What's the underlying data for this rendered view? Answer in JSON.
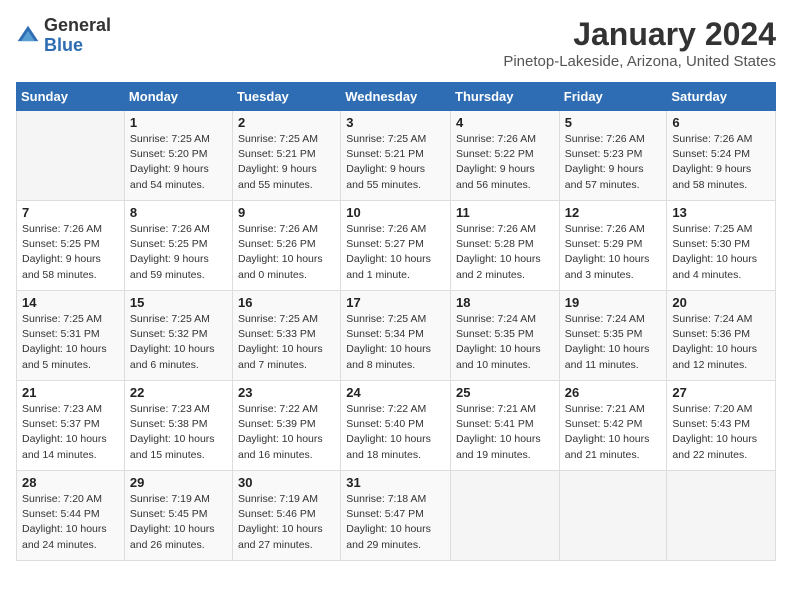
{
  "header": {
    "logo_general": "General",
    "logo_blue": "Blue",
    "month": "January 2024",
    "location": "Pinetop-Lakeside, Arizona, United States"
  },
  "days_of_week": [
    "Sunday",
    "Monday",
    "Tuesday",
    "Wednesday",
    "Thursday",
    "Friday",
    "Saturday"
  ],
  "weeks": [
    [
      {
        "day": "",
        "data": ""
      },
      {
        "day": "1",
        "data": "Sunrise: 7:25 AM\nSunset: 5:20 PM\nDaylight: 9 hours\nand 54 minutes."
      },
      {
        "day": "2",
        "data": "Sunrise: 7:25 AM\nSunset: 5:21 PM\nDaylight: 9 hours\nand 55 minutes."
      },
      {
        "day": "3",
        "data": "Sunrise: 7:25 AM\nSunset: 5:21 PM\nDaylight: 9 hours\nand 55 minutes."
      },
      {
        "day": "4",
        "data": "Sunrise: 7:26 AM\nSunset: 5:22 PM\nDaylight: 9 hours\nand 56 minutes."
      },
      {
        "day": "5",
        "data": "Sunrise: 7:26 AM\nSunset: 5:23 PM\nDaylight: 9 hours\nand 57 minutes."
      },
      {
        "day": "6",
        "data": "Sunrise: 7:26 AM\nSunset: 5:24 PM\nDaylight: 9 hours\nand 58 minutes."
      }
    ],
    [
      {
        "day": "7",
        "data": "Sunrise: 7:26 AM\nSunset: 5:25 PM\nDaylight: 9 hours\nand 58 minutes."
      },
      {
        "day": "8",
        "data": "Sunrise: 7:26 AM\nSunset: 5:25 PM\nDaylight: 9 hours\nand 59 minutes."
      },
      {
        "day": "9",
        "data": "Sunrise: 7:26 AM\nSunset: 5:26 PM\nDaylight: 10 hours\nand 0 minutes."
      },
      {
        "day": "10",
        "data": "Sunrise: 7:26 AM\nSunset: 5:27 PM\nDaylight: 10 hours\nand 1 minute."
      },
      {
        "day": "11",
        "data": "Sunrise: 7:26 AM\nSunset: 5:28 PM\nDaylight: 10 hours\nand 2 minutes."
      },
      {
        "day": "12",
        "data": "Sunrise: 7:26 AM\nSunset: 5:29 PM\nDaylight: 10 hours\nand 3 minutes."
      },
      {
        "day": "13",
        "data": "Sunrise: 7:25 AM\nSunset: 5:30 PM\nDaylight: 10 hours\nand 4 minutes."
      }
    ],
    [
      {
        "day": "14",
        "data": "Sunrise: 7:25 AM\nSunset: 5:31 PM\nDaylight: 10 hours\nand 5 minutes."
      },
      {
        "day": "15",
        "data": "Sunrise: 7:25 AM\nSunset: 5:32 PM\nDaylight: 10 hours\nand 6 minutes."
      },
      {
        "day": "16",
        "data": "Sunrise: 7:25 AM\nSunset: 5:33 PM\nDaylight: 10 hours\nand 7 minutes."
      },
      {
        "day": "17",
        "data": "Sunrise: 7:25 AM\nSunset: 5:34 PM\nDaylight: 10 hours\nand 8 minutes."
      },
      {
        "day": "18",
        "data": "Sunrise: 7:24 AM\nSunset: 5:35 PM\nDaylight: 10 hours\nand 10 minutes."
      },
      {
        "day": "19",
        "data": "Sunrise: 7:24 AM\nSunset: 5:35 PM\nDaylight: 10 hours\nand 11 minutes."
      },
      {
        "day": "20",
        "data": "Sunrise: 7:24 AM\nSunset: 5:36 PM\nDaylight: 10 hours\nand 12 minutes."
      }
    ],
    [
      {
        "day": "21",
        "data": "Sunrise: 7:23 AM\nSunset: 5:37 PM\nDaylight: 10 hours\nand 14 minutes."
      },
      {
        "day": "22",
        "data": "Sunrise: 7:23 AM\nSunset: 5:38 PM\nDaylight: 10 hours\nand 15 minutes."
      },
      {
        "day": "23",
        "data": "Sunrise: 7:22 AM\nSunset: 5:39 PM\nDaylight: 10 hours\nand 16 minutes."
      },
      {
        "day": "24",
        "data": "Sunrise: 7:22 AM\nSunset: 5:40 PM\nDaylight: 10 hours\nand 18 minutes."
      },
      {
        "day": "25",
        "data": "Sunrise: 7:21 AM\nSunset: 5:41 PM\nDaylight: 10 hours\nand 19 minutes."
      },
      {
        "day": "26",
        "data": "Sunrise: 7:21 AM\nSunset: 5:42 PM\nDaylight: 10 hours\nand 21 minutes."
      },
      {
        "day": "27",
        "data": "Sunrise: 7:20 AM\nSunset: 5:43 PM\nDaylight: 10 hours\nand 22 minutes."
      }
    ],
    [
      {
        "day": "28",
        "data": "Sunrise: 7:20 AM\nSunset: 5:44 PM\nDaylight: 10 hours\nand 24 minutes."
      },
      {
        "day": "29",
        "data": "Sunrise: 7:19 AM\nSunset: 5:45 PM\nDaylight: 10 hours\nand 26 minutes."
      },
      {
        "day": "30",
        "data": "Sunrise: 7:19 AM\nSunset: 5:46 PM\nDaylight: 10 hours\nand 27 minutes."
      },
      {
        "day": "31",
        "data": "Sunrise: 7:18 AM\nSunset: 5:47 PM\nDaylight: 10 hours\nand 29 minutes."
      },
      {
        "day": "",
        "data": ""
      },
      {
        "day": "",
        "data": ""
      },
      {
        "day": "",
        "data": ""
      }
    ]
  ]
}
